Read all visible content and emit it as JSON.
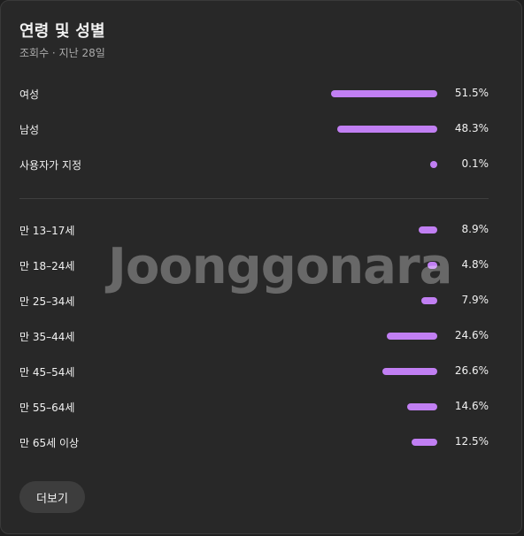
{
  "card": {
    "title": "연령 및 성별",
    "subtitle": "조회수 · 지난 28일"
  },
  "colors": {
    "bar": "#c17ff3",
    "background": "#282828",
    "button": "#3d3d3d"
  },
  "gender": [
    {
      "label": "여성",
      "percent": "51.5%",
      "value": 51.5
    },
    {
      "label": "남성",
      "percent": "48.3%",
      "value": 48.3
    },
    {
      "label": "사용자가 지정",
      "percent": "0.1%",
      "value": 0.1
    }
  ],
  "age": [
    {
      "label": "만 13–17세",
      "percent": "8.9%",
      "value": 8.9
    },
    {
      "label": "만 18–24세",
      "percent": "4.8%",
      "value": 4.8
    },
    {
      "label": "만 25–34세",
      "percent": "7.9%",
      "value": 7.9
    },
    {
      "label": "만 35–44세",
      "percent": "24.6%",
      "value": 24.6
    },
    {
      "label": "만 45–54세",
      "percent": "26.6%",
      "value": 26.6
    },
    {
      "label": "만 55–64세",
      "percent": "14.6%",
      "value": 14.6
    },
    {
      "label": "만 65세 이상",
      "percent": "12.5%",
      "value": 12.5
    }
  ],
  "actions": {
    "more_label": "더보기"
  },
  "watermark": {
    "text": "Joonggonara"
  }
}
